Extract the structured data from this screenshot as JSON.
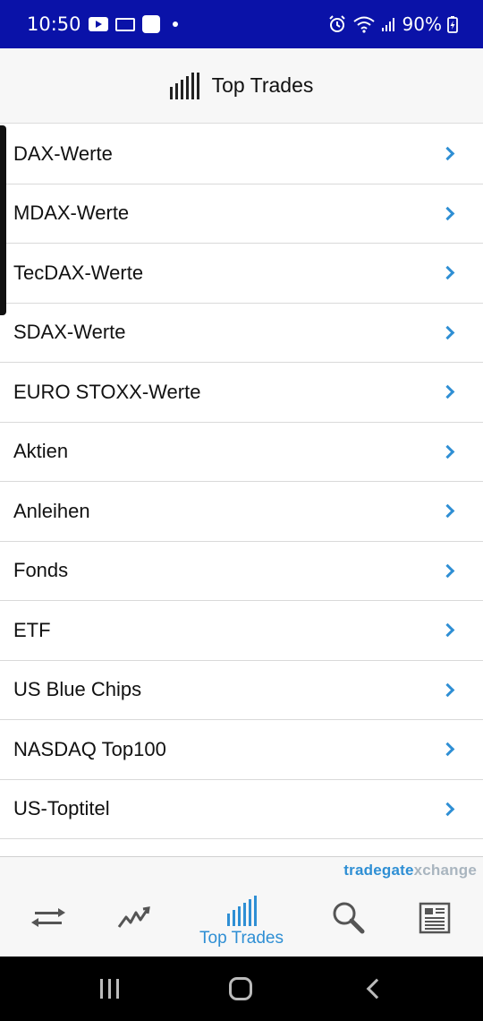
{
  "status_bar": {
    "time": "10:50",
    "battery": "90%"
  },
  "header": {
    "title": "Top Trades"
  },
  "list": {
    "items": [
      {
        "label": "DAX-Werte"
      },
      {
        "label": "MDAX-Werte"
      },
      {
        "label": "TecDAX-Werte"
      },
      {
        "label": "SDAX-Werte"
      },
      {
        "label": "EURO STOXX-Werte"
      },
      {
        "label": "Aktien"
      },
      {
        "label": "Anleihen"
      },
      {
        "label": "Fonds"
      },
      {
        "label": "ETF"
      },
      {
        "label": "US Blue Chips"
      },
      {
        "label": "NASDAQ Top100"
      },
      {
        "label": "US-Toptitel"
      }
    ]
  },
  "brand": {
    "part1": "tradegate",
    "part2": "xchange",
    "full": "tradegatexchange"
  },
  "tab_bar": {
    "tabs": [
      {
        "icon": "transfer-icon",
        "label": ""
      },
      {
        "icon": "chart-line-icon",
        "label": ""
      },
      {
        "icon": "bar-chart-icon",
        "label": "Top Trades",
        "active": true
      },
      {
        "icon": "search-icon",
        "label": ""
      },
      {
        "icon": "news-icon",
        "label": ""
      }
    ]
  },
  "colors": {
    "status_bar_bg": "#0a12a8",
    "accent": "#2f8fd4",
    "header_bg": "#f7f7f7"
  }
}
